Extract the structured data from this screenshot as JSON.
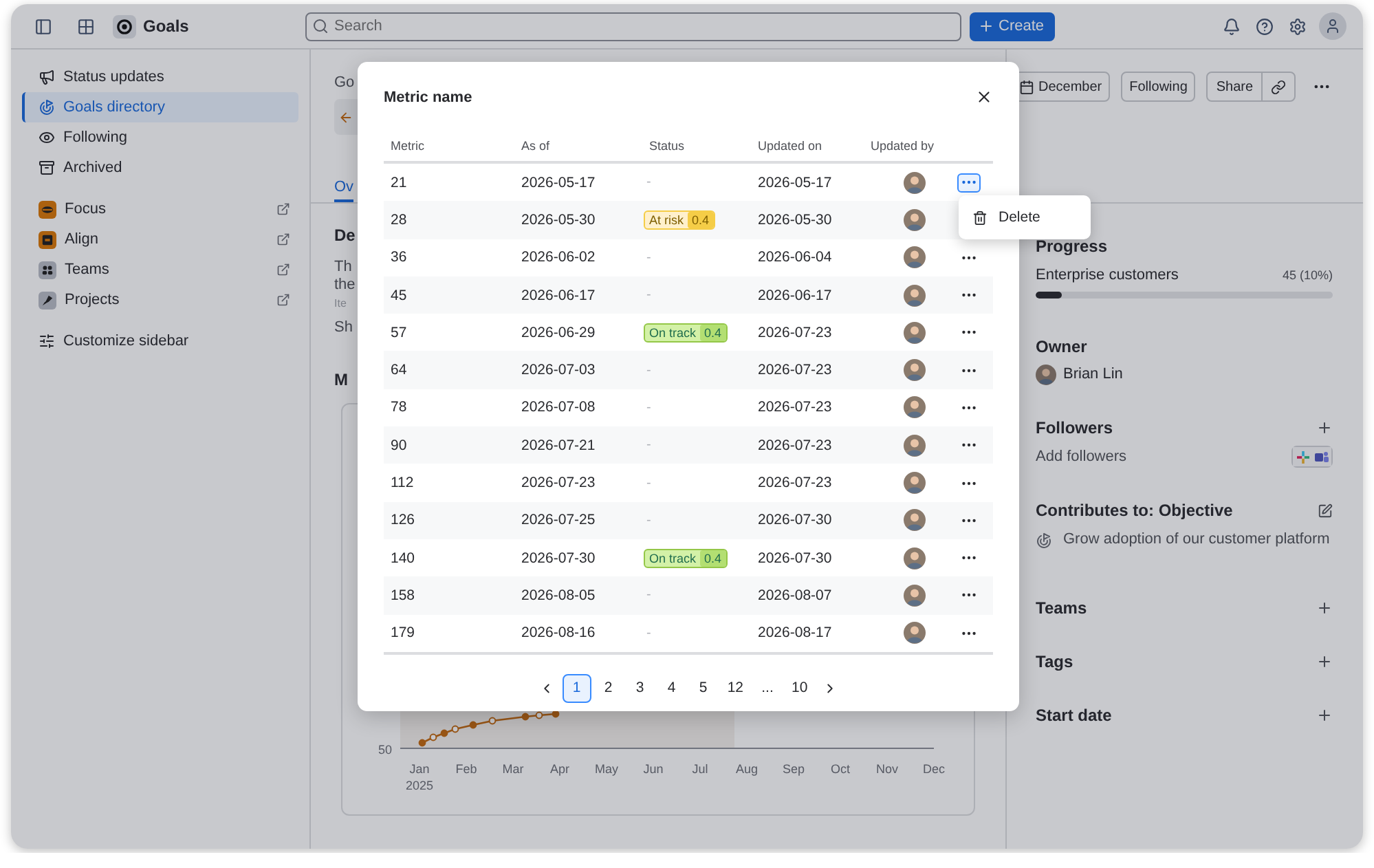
{
  "topbar": {
    "app_name": "Goals",
    "search": {
      "placeholder": "Search"
    },
    "create_button": "Create"
  },
  "sidebar": {
    "items": [
      {
        "label": "Status updates",
        "kind": "updates",
        "selected": false
      },
      {
        "label": "Goals directory",
        "kind": "goals",
        "selected": true
      },
      {
        "label": "Following",
        "kind": "following",
        "selected": false
      },
      {
        "label": "Archived",
        "kind": "archived",
        "selected": false
      }
    ],
    "apps": [
      {
        "label": "Focus",
        "kind": "focus"
      },
      {
        "label": "Align",
        "kind": "align"
      },
      {
        "label": "Teams",
        "kind": "teams"
      },
      {
        "label": "Projects",
        "kind": "projects"
      }
    ],
    "customize": "Customize sidebar"
  },
  "main": {
    "breadcrumb": "Go",
    "tab": "Ov",
    "description": {
      "heading": "De",
      "lines": [
        "Th",
        "the"
      ],
      "hint": "Ite",
      "more": "Sh"
    },
    "metric_heading": "M",
    "chart": {
      "y_tick": "50",
      "months": [
        "Jan",
        "Feb",
        "Mar",
        "Apr",
        "May",
        "Jun",
        "Jul",
        "Aug",
        "Sep",
        "Oct",
        "Nov",
        "Dec"
      ],
      "year": "2025"
    }
  },
  "right_panel": {
    "actions": {
      "date": "December",
      "follow": "Following",
      "share": "Share"
    },
    "progress": {
      "heading": "Progress",
      "metric": "Enterprise customers",
      "value": "45 (10%)",
      "level": 0.09
    },
    "owner": {
      "heading": "Owner",
      "name": "Brian Lin"
    },
    "followers": {
      "heading": "Followers",
      "add": "Add followers"
    },
    "contributes": {
      "heading": "Contributes to: Objective",
      "objective": "Grow adoption of our customer platform"
    },
    "sections": [
      "Teams",
      "Tags",
      "Start date"
    ]
  },
  "modal": {
    "title": "Metric name",
    "columns": [
      "Metric",
      "As of",
      "Status",
      "Updated on",
      "Updated by"
    ],
    "rows": [
      {
        "metric": "21",
        "as_of": "2026-05-17",
        "status": {
          "kind": "none",
          "label": "-"
        },
        "updated_on": "2026-05-17",
        "menu_open": true
      },
      {
        "metric": "28",
        "as_of": "2026-05-30",
        "status": {
          "kind": "at_risk",
          "label": "At risk",
          "score": "0.4"
        },
        "updated_on": "2026-05-30",
        "menu_open": false
      },
      {
        "metric": "36",
        "as_of": "2026-06-02",
        "status": {
          "kind": "none",
          "label": "-"
        },
        "updated_on": "2026-06-04",
        "menu_open": false
      },
      {
        "metric": "45",
        "as_of": "2026-06-17",
        "status": {
          "kind": "none",
          "label": "-"
        },
        "updated_on": "2026-06-17",
        "menu_open": false
      },
      {
        "metric": "57",
        "as_of": "2026-06-29",
        "status": {
          "kind": "on_track",
          "label": "On track",
          "score": "0.4"
        },
        "updated_on": "2026-07-23",
        "menu_open": false
      },
      {
        "metric": "64",
        "as_of": "2026-07-03",
        "status": {
          "kind": "none",
          "label": "-"
        },
        "updated_on": "2026-07-23",
        "menu_open": false
      },
      {
        "metric": "78",
        "as_of": "2026-07-08",
        "status": {
          "kind": "none",
          "label": "-"
        },
        "updated_on": "2026-07-23",
        "menu_open": false
      },
      {
        "metric": "90",
        "as_of": "2026-07-21",
        "status": {
          "kind": "none",
          "label": "-"
        },
        "updated_on": "2026-07-23",
        "menu_open": false
      },
      {
        "metric": "112",
        "as_of": "2026-07-23",
        "status": {
          "kind": "none",
          "label": "-"
        },
        "updated_on": "2026-07-23",
        "menu_open": false
      },
      {
        "metric": "126",
        "as_of": "2026-07-25",
        "status": {
          "kind": "none",
          "label": "-"
        },
        "updated_on": "2026-07-30",
        "menu_open": false
      },
      {
        "metric": "140",
        "as_of": "2026-07-30",
        "status": {
          "kind": "on_track",
          "label": "On track",
          "score": "0.4"
        },
        "updated_on": "2026-07-30",
        "menu_open": false
      },
      {
        "metric": "158",
        "as_of": "2026-08-05",
        "status": {
          "kind": "none",
          "label": "-"
        },
        "updated_on": "2026-08-07",
        "menu_open": false
      },
      {
        "metric": "179",
        "as_of": "2026-08-16",
        "status": {
          "kind": "none",
          "label": "-"
        },
        "updated_on": "2026-08-17",
        "menu_open": false
      }
    ],
    "menu": {
      "items": [
        "Delete"
      ]
    },
    "pagination": [
      {
        "label": "1",
        "selected": true
      },
      {
        "label": "2",
        "selected": false
      },
      {
        "label": "3",
        "selected": false
      },
      {
        "label": "4",
        "selected": false
      },
      {
        "label": "5",
        "selected": false
      },
      {
        "label": "12",
        "selected": false
      },
      {
        "label": "...",
        "selected": false
      },
      {
        "label": "10",
        "selected": false
      }
    ]
  }
}
